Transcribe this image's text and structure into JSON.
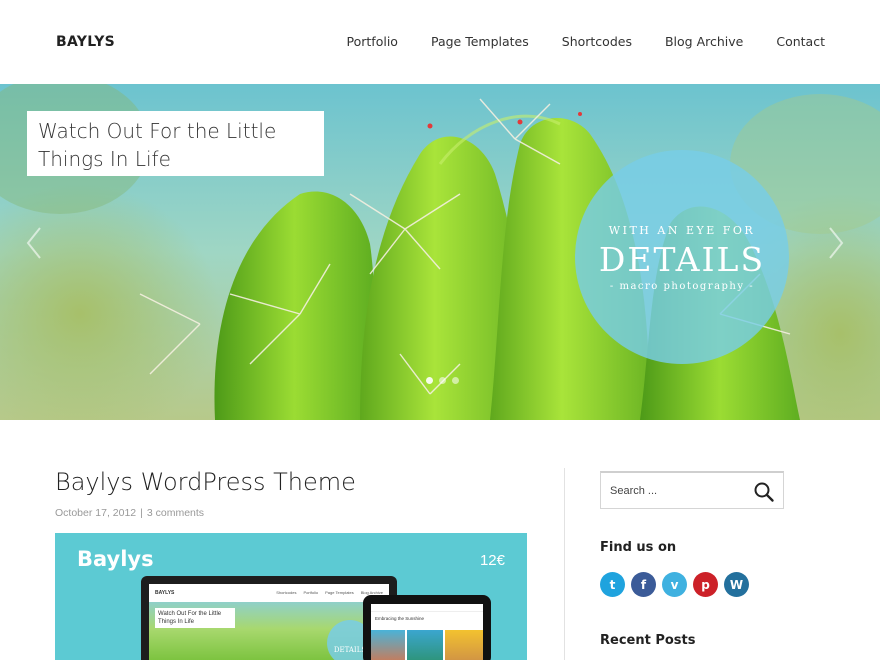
{
  "header": {
    "logo": "BAYLYS",
    "nav": [
      "Portfolio",
      "Page Templates",
      "Shortcodes",
      "Blog Archive",
      "Contact"
    ]
  },
  "hero": {
    "caption": "Watch Out For the Little Things In Life",
    "badge": {
      "top": "WITH AN EYE FOR",
      "main": "DETAILS",
      "sub": "- macro photography -"
    },
    "slides_total": 3,
    "active_slide": 1
  },
  "post": {
    "title": "Baylys WordPress Theme",
    "date": "October 17, 2012",
    "separator": "|",
    "comments": "3 comments",
    "image": {
      "brand": "Baylys",
      "price": "12€",
      "monitor_logo": "BAYLYS",
      "monitor_nav": [
        "Shortcodes",
        "Portfolio",
        "Page Templates",
        "Blog Archive"
      ],
      "monitor_caption": "Watch Out For the Little Things In Life",
      "monitor_badge": "DETAILS",
      "tablet_caption": "Embracing the Sunshine"
    }
  },
  "sidebar": {
    "search_placeholder": "Search ...",
    "find_us_title": "Find us on",
    "social": [
      {
        "name": "twitter",
        "glyph": "t",
        "color": "#1fa3de"
      },
      {
        "name": "facebook",
        "glyph": "f",
        "color": "#3b5b98"
      },
      {
        "name": "vimeo",
        "glyph": "v",
        "color": "#3fb1e0"
      },
      {
        "name": "pinterest",
        "glyph": "p",
        "color": "#cc2128"
      },
      {
        "name": "wordpress",
        "glyph": "W",
        "color": "#23709d"
      }
    ],
    "recent_posts_title": "Recent Posts"
  }
}
